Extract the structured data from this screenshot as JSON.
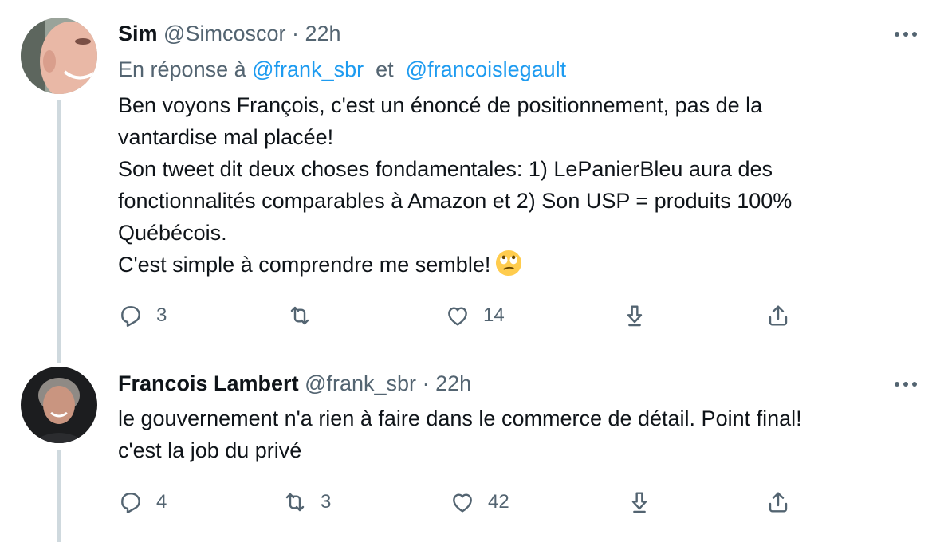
{
  "tweets": [
    {
      "name": "Sim",
      "handle": "@Simcoscor",
      "separator": "·",
      "time": "22h",
      "replying_prefix": "En réponse à",
      "replying_mentions": [
        "@frank_sbr",
        "@francoislegault"
      ],
      "replying_joiner": "et",
      "text_lines": [
        "Ben voyons François, c'est un énoncé de positionnement, pas de la",
        "vantardise mal placée!",
        "Son tweet dit deux choses fondamentales: 1) LePanierBleu aura des",
        "fonctionnalités comparables à Amazon et 2) Son USP = produits 100%",
        "Québécois.",
        "C'est simple à comprendre me semble!"
      ],
      "emoji": "face-with-rolling-eyes",
      "reply_count": "3",
      "retweet_count": "",
      "like_count": "14"
    },
    {
      "name": "Francois Lambert",
      "handle": "@frank_sbr",
      "separator": "·",
      "time": "22h",
      "text_lines": [
        "le gouvernement n'a rien à faire dans le commerce de détail. Point final!",
        "c'est la job du privé"
      ],
      "reply_count": "4",
      "retweet_count": "3",
      "like_count": "42"
    }
  ],
  "colors": {
    "text": "#0f1419",
    "secondary": "#536471",
    "link": "#1d9bf0",
    "thread_line": "#cfd9de"
  },
  "icons": [
    "more-icon",
    "reply-icon",
    "retweet-icon",
    "like-icon",
    "download-icon",
    "share-icon"
  ]
}
